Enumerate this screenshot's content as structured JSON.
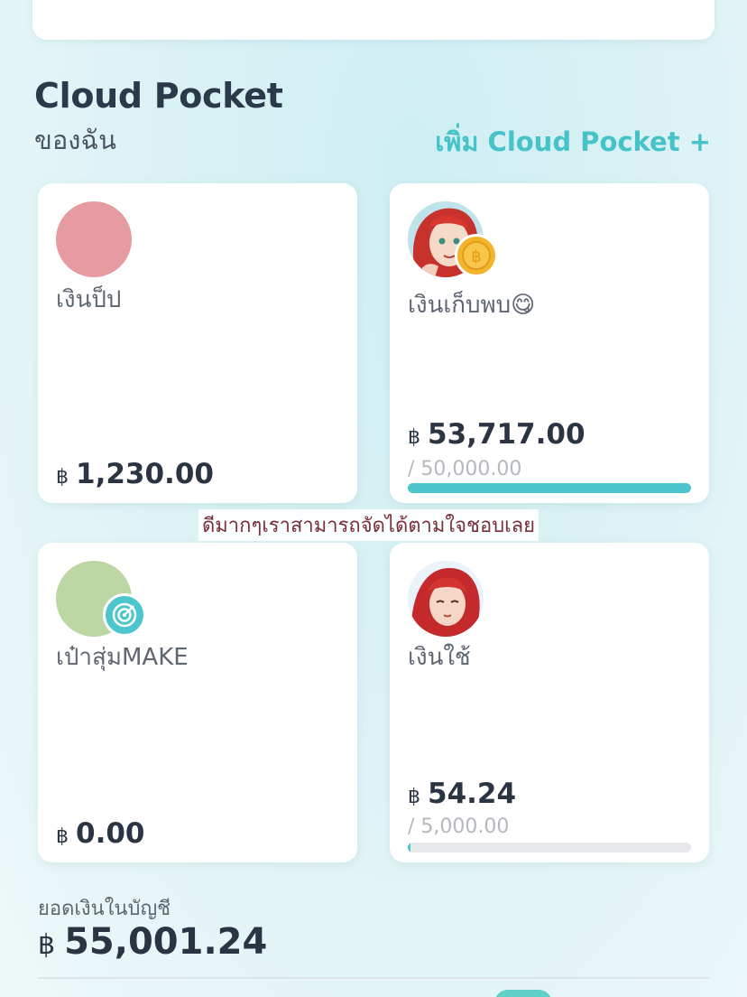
{
  "section": {
    "title": "Cloud Pocket",
    "subtitle": "ของฉัน",
    "add_link": "เพิ่ม Cloud Pocket +"
  },
  "pockets": [
    {
      "name": "เงินป็ป",
      "currency": "฿",
      "amount": "1,230.00",
      "avatar": "pink-circle",
      "color": "#e69ba1"
    },
    {
      "name": "เงินเก็บพบ😋",
      "currency": "฿",
      "amount": "53,717.00",
      "goal": "/ 50,000.00",
      "progress": 1.0,
      "avatar": "red-hair-girl-avatar",
      "badge": "baht-coin-icon"
    },
    {
      "name": "เป๋าสุ่มMAKE",
      "currency": "฿",
      "amount": "0.00",
      "avatar": "green-circle",
      "color": "#bcd6a4",
      "badge": "target-icon"
    },
    {
      "name": "เงินใช้",
      "currency": "฿",
      "amount": "54.24",
      "goal": "/ 5,000.00",
      "progress": 0.011,
      "avatar": "red-hair-girl-avatar-2"
    }
  ],
  "overlay_caption": "ดีมากๆเราสามารถจัดได้ตามใจชอบเลย",
  "account": {
    "label": "ยอดเงินในบัญชี",
    "currency": "฿",
    "balance": "55,001.24"
  },
  "colors": {
    "accent": "#45c3c8",
    "progress": "#4cc6cc",
    "coin": "#f4b52a"
  }
}
